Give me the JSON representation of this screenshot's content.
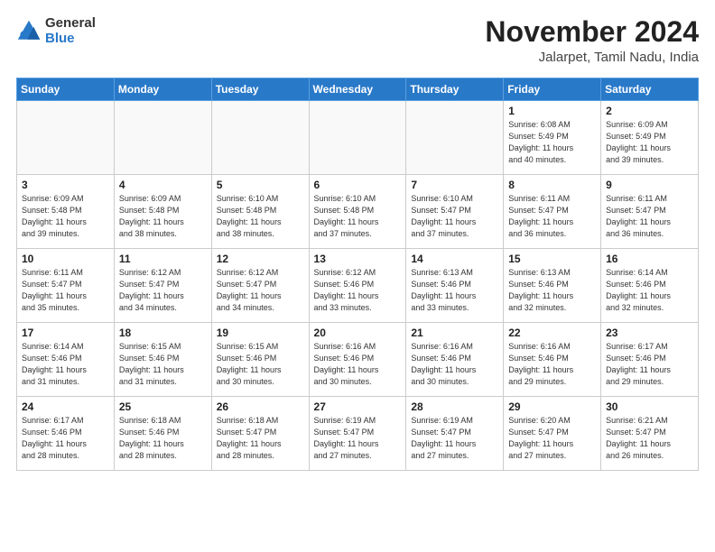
{
  "header": {
    "logo_general": "General",
    "logo_blue": "Blue",
    "month_title": "November 2024",
    "location": "Jalarpet, Tamil Nadu, India"
  },
  "weekdays": [
    "Sunday",
    "Monday",
    "Tuesday",
    "Wednesday",
    "Thursday",
    "Friday",
    "Saturday"
  ],
  "weeks": [
    [
      {
        "day": "",
        "info": ""
      },
      {
        "day": "",
        "info": ""
      },
      {
        "day": "",
        "info": ""
      },
      {
        "day": "",
        "info": ""
      },
      {
        "day": "",
        "info": ""
      },
      {
        "day": "1",
        "info": "Sunrise: 6:08 AM\nSunset: 5:49 PM\nDaylight: 11 hours\nand 40 minutes."
      },
      {
        "day": "2",
        "info": "Sunrise: 6:09 AM\nSunset: 5:49 PM\nDaylight: 11 hours\nand 39 minutes."
      }
    ],
    [
      {
        "day": "3",
        "info": "Sunrise: 6:09 AM\nSunset: 5:48 PM\nDaylight: 11 hours\nand 39 minutes."
      },
      {
        "day": "4",
        "info": "Sunrise: 6:09 AM\nSunset: 5:48 PM\nDaylight: 11 hours\nand 38 minutes."
      },
      {
        "day": "5",
        "info": "Sunrise: 6:10 AM\nSunset: 5:48 PM\nDaylight: 11 hours\nand 38 minutes."
      },
      {
        "day": "6",
        "info": "Sunrise: 6:10 AM\nSunset: 5:48 PM\nDaylight: 11 hours\nand 37 minutes."
      },
      {
        "day": "7",
        "info": "Sunrise: 6:10 AM\nSunset: 5:47 PM\nDaylight: 11 hours\nand 37 minutes."
      },
      {
        "day": "8",
        "info": "Sunrise: 6:11 AM\nSunset: 5:47 PM\nDaylight: 11 hours\nand 36 minutes."
      },
      {
        "day": "9",
        "info": "Sunrise: 6:11 AM\nSunset: 5:47 PM\nDaylight: 11 hours\nand 36 minutes."
      }
    ],
    [
      {
        "day": "10",
        "info": "Sunrise: 6:11 AM\nSunset: 5:47 PM\nDaylight: 11 hours\nand 35 minutes."
      },
      {
        "day": "11",
        "info": "Sunrise: 6:12 AM\nSunset: 5:47 PM\nDaylight: 11 hours\nand 34 minutes."
      },
      {
        "day": "12",
        "info": "Sunrise: 6:12 AM\nSunset: 5:47 PM\nDaylight: 11 hours\nand 34 minutes."
      },
      {
        "day": "13",
        "info": "Sunrise: 6:12 AM\nSunset: 5:46 PM\nDaylight: 11 hours\nand 33 minutes."
      },
      {
        "day": "14",
        "info": "Sunrise: 6:13 AM\nSunset: 5:46 PM\nDaylight: 11 hours\nand 33 minutes."
      },
      {
        "day": "15",
        "info": "Sunrise: 6:13 AM\nSunset: 5:46 PM\nDaylight: 11 hours\nand 32 minutes."
      },
      {
        "day": "16",
        "info": "Sunrise: 6:14 AM\nSunset: 5:46 PM\nDaylight: 11 hours\nand 32 minutes."
      }
    ],
    [
      {
        "day": "17",
        "info": "Sunrise: 6:14 AM\nSunset: 5:46 PM\nDaylight: 11 hours\nand 31 minutes."
      },
      {
        "day": "18",
        "info": "Sunrise: 6:15 AM\nSunset: 5:46 PM\nDaylight: 11 hours\nand 31 minutes."
      },
      {
        "day": "19",
        "info": "Sunrise: 6:15 AM\nSunset: 5:46 PM\nDaylight: 11 hours\nand 30 minutes."
      },
      {
        "day": "20",
        "info": "Sunrise: 6:16 AM\nSunset: 5:46 PM\nDaylight: 11 hours\nand 30 minutes."
      },
      {
        "day": "21",
        "info": "Sunrise: 6:16 AM\nSunset: 5:46 PM\nDaylight: 11 hours\nand 30 minutes."
      },
      {
        "day": "22",
        "info": "Sunrise: 6:16 AM\nSunset: 5:46 PM\nDaylight: 11 hours\nand 29 minutes."
      },
      {
        "day": "23",
        "info": "Sunrise: 6:17 AM\nSunset: 5:46 PM\nDaylight: 11 hours\nand 29 minutes."
      }
    ],
    [
      {
        "day": "24",
        "info": "Sunrise: 6:17 AM\nSunset: 5:46 PM\nDaylight: 11 hours\nand 28 minutes."
      },
      {
        "day": "25",
        "info": "Sunrise: 6:18 AM\nSunset: 5:46 PM\nDaylight: 11 hours\nand 28 minutes."
      },
      {
        "day": "26",
        "info": "Sunrise: 6:18 AM\nSunset: 5:47 PM\nDaylight: 11 hours\nand 28 minutes."
      },
      {
        "day": "27",
        "info": "Sunrise: 6:19 AM\nSunset: 5:47 PM\nDaylight: 11 hours\nand 27 minutes."
      },
      {
        "day": "28",
        "info": "Sunrise: 6:19 AM\nSunset: 5:47 PM\nDaylight: 11 hours\nand 27 minutes."
      },
      {
        "day": "29",
        "info": "Sunrise: 6:20 AM\nSunset: 5:47 PM\nDaylight: 11 hours\nand 27 minutes."
      },
      {
        "day": "30",
        "info": "Sunrise: 6:21 AM\nSunset: 5:47 PM\nDaylight: 11 hours\nand 26 minutes."
      }
    ]
  ]
}
